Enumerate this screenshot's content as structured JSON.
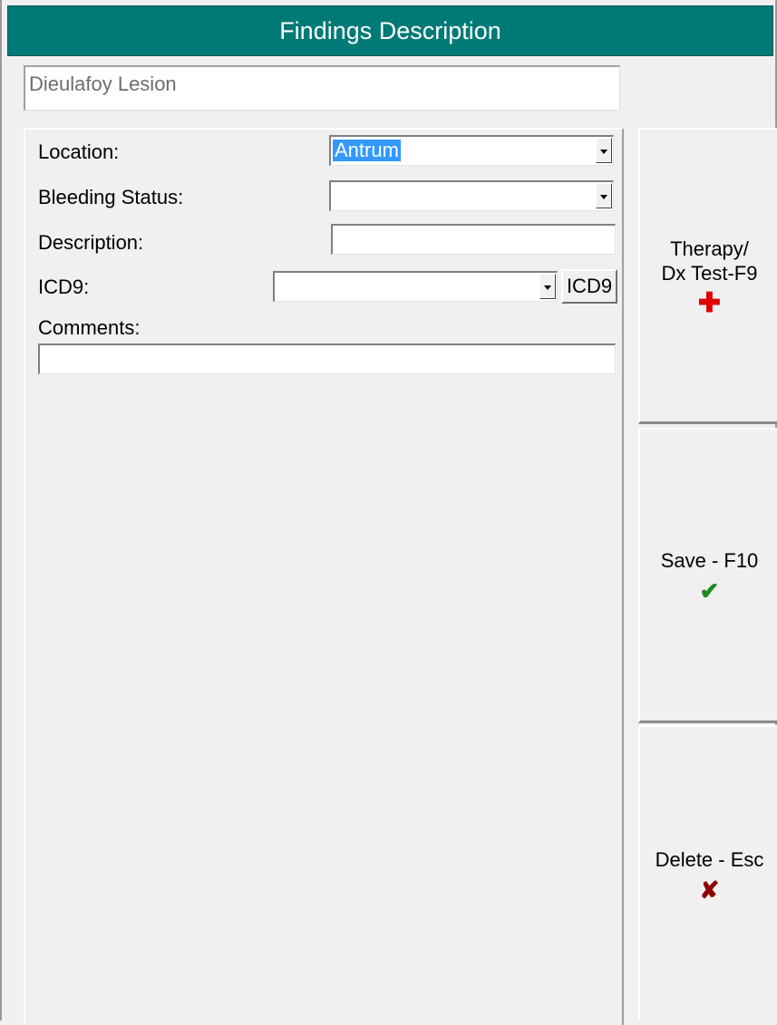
{
  "window": {
    "title": "Findings Description"
  },
  "finding": {
    "name": "Dieulafoy Lesion"
  },
  "form": {
    "location": {
      "label": "Location:",
      "value": "Antrum"
    },
    "bleeding_status": {
      "label": "Bleeding Status:",
      "value": ""
    },
    "description": {
      "label": "Description:",
      "value": ""
    },
    "icd9": {
      "label": "ICD9:",
      "value": "",
      "button_label": "ICD9"
    },
    "comments": {
      "label": "Comments:",
      "value": ""
    }
  },
  "side_buttons": {
    "therapy": {
      "line1": "Therapy/",
      "line2": "Dx Test-F9",
      "icon": "red-cross-icon"
    },
    "save": {
      "label": "Save - F10",
      "icon": "green-check-icon"
    },
    "delete": {
      "label": "Delete - Esc",
      "icon": "red-x-icon"
    }
  },
  "colors": {
    "title_bg": "#007a76",
    "selection": "#3399ff"
  }
}
